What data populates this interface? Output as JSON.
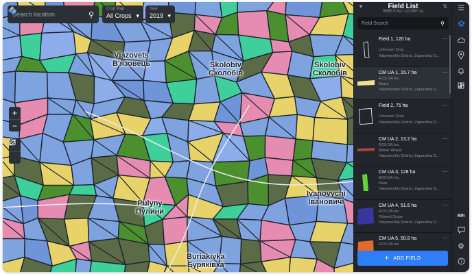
{
  "map": {
    "search_placeholder": "Search location",
    "crop_map_label": "Crop Map",
    "crop_map_value": "All Crops",
    "year_label": "Year",
    "year_value": "2019",
    "zoom_in": "+",
    "zoom_out": "−",
    "places": [
      {
        "line1": "Viazovets",
        "line2": "В'язовець"
      },
      {
        "line1": "Skolobiv",
        "line2": "Сколобів"
      },
      {
        "line1": "Skolobiv",
        "line2": "Сколобів"
      },
      {
        "line1": "Ivanovychi",
        "line2": "Івановичі"
      },
      {
        "line1": "Pulyny",
        "line2": "Пулини"
      },
      {
        "line1": "Buriakivka",
        "line2": "Бурякiвка"
      }
    ]
  },
  "panel": {
    "title": "Field List",
    "subtitle": "5680.5 ha / 10,000 ha",
    "search_placeholder": "Field Search",
    "add_button": "ADD FIELD",
    "fields": [
      {
        "title": "Field 1, 120 ha",
        "owner": "",
        "crop": "Unknown Crop",
        "location": "Yakymivs'kiy District, Zaporizhia O...",
        "color": "#2b3036",
        "shape": "outline-tall"
      },
      {
        "title": "CM UA 1, 15.7 ha",
        "owner": "EOS DA Inc.",
        "crop": "Maize",
        "location": "Yakymivs'kiy District, Zaporizhia O...",
        "color": "#f1e08a",
        "shape": "band"
      },
      {
        "title": "Field 2, 75 ha",
        "owner": "",
        "crop": "Unknown Crop",
        "location": "Yakymivs'kiy District, Zaporizhia O...",
        "color": "#2b3036",
        "shape": "outline-square"
      },
      {
        "title": "CM UA 2, 13.2 ha",
        "owner": "EOS DA Inc.",
        "crop": "Winter Wheat",
        "location": "Yakymivs'kiy District, Zaporizhia O...",
        "color": "#a34a3c",
        "shape": "thin-band"
      },
      {
        "title": "CM UA 3, 128 ha",
        "owner": "EOS DA Inc.",
        "crop": "Peas",
        "location": "Yakymivs'kiy District, Zaporizhia O...",
        "color": "#63d13b",
        "shape": "tall"
      },
      {
        "title": "CM UA 4, 51.6 ha",
        "owner": "EOS DA Inc.",
        "crop": "Oilseed Crops",
        "location": "Yakymivs'kiy District, Zaporizhia O...",
        "color": "#3a36a0",
        "shape": "square"
      },
      {
        "title": "CM UA 5, 50.8 ha",
        "owner": "EOS DA Inc.",
        "crop": "",
        "location": "",
        "color": "#e36b2a",
        "shape": "square"
      }
    ]
  },
  "rail": {
    "rpi_label": "RPI"
  }
}
